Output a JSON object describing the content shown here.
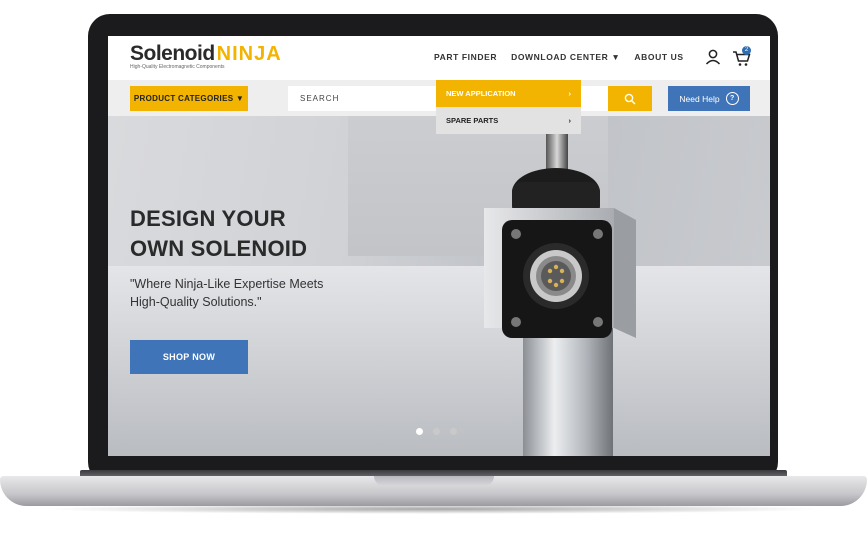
{
  "brand": {
    "name_main": "Solenoid",
    "name_accent": "NINJA",
    "tagline": "High-Quality Electromagnetic Components"
  },
  "nav": {
    "items": [
      {
        "label": "PART FINDER"
      },
      {
        "label": "DOWNLOAD CENTER",
        "has_dropdown": true
      },
      {
        "label": "ABOUT US"
      }
    ],
    "cart_count": "2",
    "chevron": "⌄"
  },
  "toolbar": {
    "categories_label": "PRODUCT CATEGORIES",
    "search_placeholder": "SEARCH",
    "help_label": "Need Help",
    "help_icon": "?"
  },
  "dropdown": {
    "items": [
      {
        "label": "NEW APPLICATION",
        "arrow": "›",
        "active": true
      },
      {
        "label": "SPARE PARTS",
        "arrow": "›",
        "active": false
      }
    ]
  },
  "hero": {
    "headline_line1": "DESIGN YOUR",
    "headline_line2": "OWN SOLENOID",
    "quote_line1": "\"Where Ninja-Like Expertise Meets",
    "quote_line2": "High-Quality Solutions.\"",
    "cta_label": "SHOP NOW",
    "slides": 3,
    "active_slide": 1
  },
  "colors": {
    "accent": "#f2b400",
    "primary": "#3f75b8",
    "text": "#2a2a2a"
  }
}
